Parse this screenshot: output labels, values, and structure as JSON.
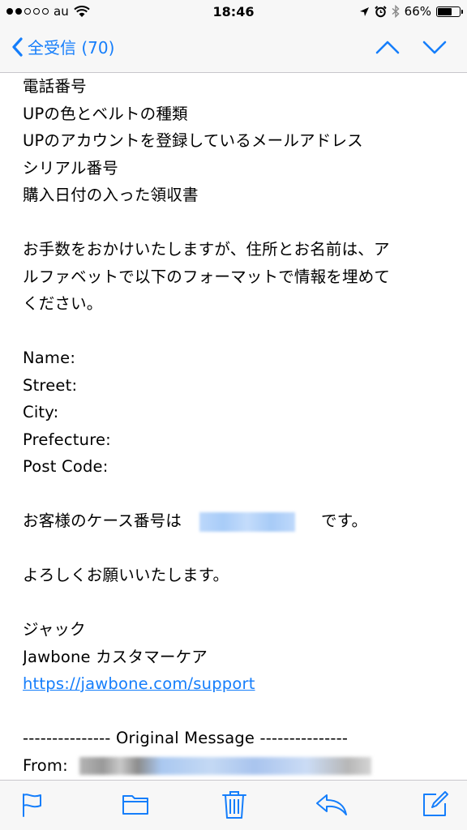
{
  "status_bar": {
    "carrier": "au",
    "time": "18:46",
    "battery_text": "66%",
    "battery_level": 0.66,
    "signal_bars": 2,
    "signal_total": 5
  },
  "nav": {
    "back_label": "全受信 (70)"
  },
  "body": {
    "lines": [
      "電話番号",
      "UPの色とベルトの種類",
      "UPのアカウントを登録しているメールアドレス",
      "シリアル番号",
      "購入日付の入った領収書"
    ],
    "request_text": [
      "お手数をおかけいたしますが、住所とお名前は、ア",
      "ルファベットで以下のフォーマットで情報を埋めて",
      "ください。"
    ],
    "fields": [
      "Name:",
      "Street:",
      "City:",
      "Prefecture:",
      "Post Code:"
    ],
    "case_prefix": "お客様のケース番号は",
    "case_suffix": "です。",
    "closing": "よろしくお願いいたします。",
    "signature_name": "ジャック",
    "signature_team": "Jawbone カスタマーケア",
    "support_link": "https://jawbone.com/support",
    "original_message": "--------------- Original Message ---------------",
    "from_label": "From:"
  },
  "toolbar": {
    "icons": [
      "flag-icon",
      "folder-icon",
      "trash-icon",
      "reply-icon",
      "compose-icon"
    ]
  },
  "colors": {
    "accent": "#157efb",
    "bar_background": "#f7f7f7"
  }
}
